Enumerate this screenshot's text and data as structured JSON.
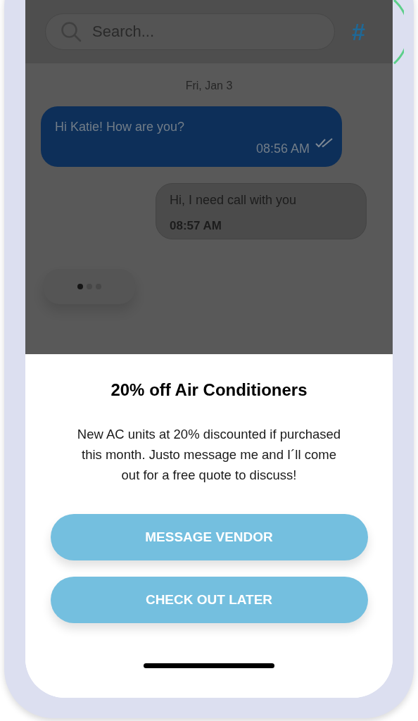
{
  "search": {
    "placeholder": "Search..."
  },
  "header_action": "#",
  "date_label": "Fri, Jan 3",
  "messages": [
    {
      "kind": "sent",
      "text": "Hi Katie! How are you?",
      "time": "08:56 AM",
      "read": true
    },
    {
      "kind": "received",
      "text": "Hi, I need call with you",
      "time": "08:57 AM"
    }
  ],
  "typing": true,
  "sheet": {
    "title": "20% off Air Conditioners",
    "body": "New AC units at 20% discounted if purchased this month. Justo message me and I´ll come out for a free quote to discuss!",
    "buttons": [
      "MESSAGE VENDOR",
      "CHECK OUT LATER"
    ]
  }
}
